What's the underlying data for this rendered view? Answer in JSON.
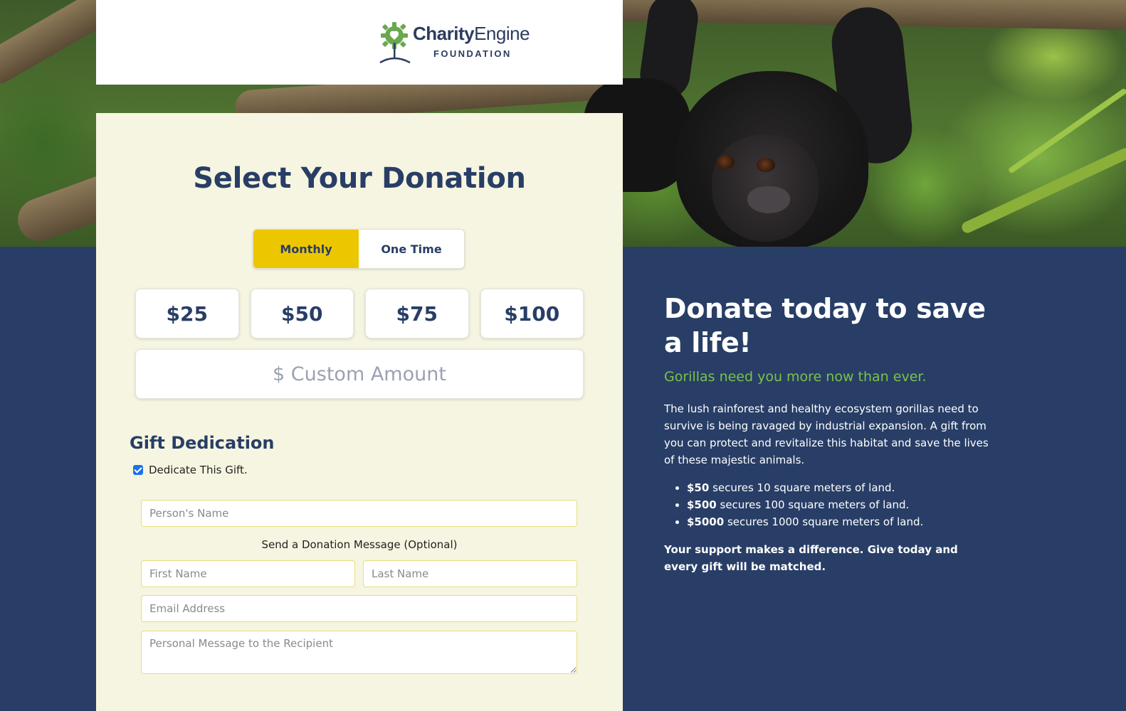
{
  "brand": {
    "logo_name_bold": "Charity",
    "logo_name_light": "Engine",
    "logo_sub": "FOUNDATION"
  },
  "donation": {
    "title": "Select Your Donation",
    "frequency": {
      "options": [
        "Monthly",
        "One Time"
      ],
      "selected": "Monthly"
    },
    "amounts": [
      "$25",
      "$50",
      "$75",
      "$100"
    ],
    "custom_amount_placeholder": "$ Custom Amount"
  },
  "gift": {
    "title": "Gift Dedication",
    "dedicate_label": "Dedicate This Gift.",
    "dedicate_checked": true,
    "person_name_placeholder": "Person's Name",
    "message_label": "Send a Donation Message (Optional)",
    "first_name_placeholder": "First Name",
    "last_name_placeholder": "Last Name",
    "email_placeholder": "Email Address",
    "message_placeholder": "Personal Message to the Recipient"
  },
  "info": {
    "headline": "Donate today to save a life!",
    "subheadline": "Gorillas need you more now than ever.",
    "body": "The lush rainforest and healthy ecosystem gorillas need to survive is being ravaged by industrial expansion. A gift from you can protect and revitalize this habitat and save the lives of these majestic animals.",
    "bullets": [
      {
        "amount": "$50",
        "text": " secures 10 square meters of land."
      },
      {
        "amount": "$500",
        "text": " secures 100 square meters of land."
      },
      {
        "amount": "$5000",
        "text": " secures 1000 square meters of land."
      }
    ],
    "closing": "Your support makes a difference. Give today and every gift will be matched."
  },
  "colors": {
    "navy": "#283e66",
    "accent_yellow": "#ecc700",
    "accent_green": "#7bc249",
    "panel_cream": "#f6f5e1"
  }
}
